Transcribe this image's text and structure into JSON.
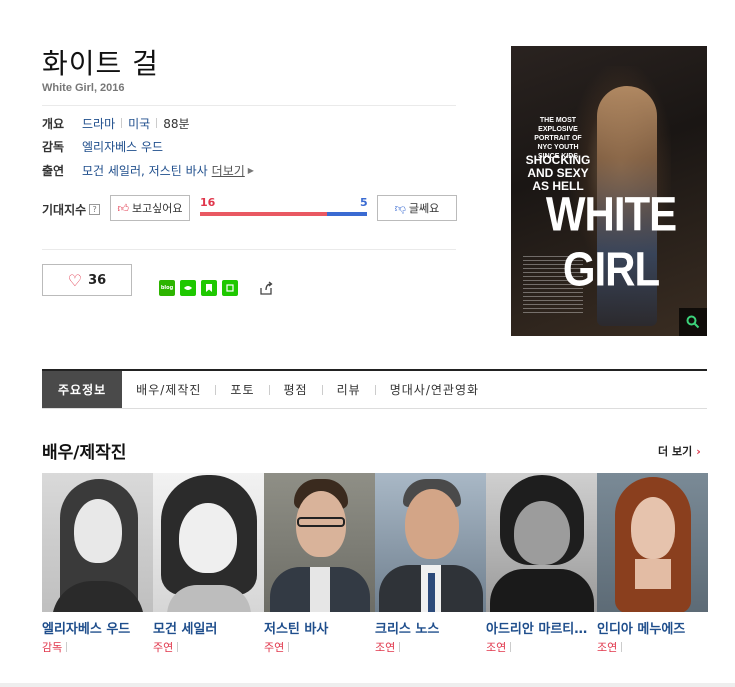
{
  "movie": {
    "title": "화이트 걸",
    "subtitle": "White Girl, 2016"
  },
  "info": {
    "overview_label": "개요",
    "genre": "드라마",
    "country": "미국",
    "runtime": "88분",
    "director_label": "감독",
    "director": "엘리자베스 우드",
    "cast_label": "출연",
    "cast_list": "모건 세일러, 저스틴 바사",
    "more": "더보기"
  },
  "expectation": {
    "label": "기대지수",
    "help": "?",
    "want_label": "보고싶어요",
    "no_label": "글쎄요",
    "want_count": "16",
    "no_count": "5",
    "want_fraction": 0.762
  },
  "like": {
    "count": "36"
  },
  "share": {
    "blog": "blog"
  },
  "poster": {
    "tagline": "THE MOST EXPLOSIVE PORTRAIT OF NYC YOUTH SINCE KIDS",
    "shock": "SHOCKING AND SEXY AS HELL",
    "main_title": "WHITE GIRL"
  },
  "tabs": [
    {
      "label": "주요정보"
    },
    {
      "label": "배우/제작진"
    },
    {
      "label": "포토"
    },
    {
      "label": "평점"
    },
    {
      "label": "리뷰"
    },
    {
      "label": "명대사/연관영화"
    }
  ],
  "section": {
    "title": "배우/제작진",
    "more": "더 보기"
  },
  "cast": [
    {
      "name": "엘리자베스 우드",
      "role": "감독"
    },
    {
      "name": "모건 세일러",
      "role": "주연"
    },
    {
      "name": "저스틴 바사",
      "role": "주연"
    },
    {
      "name": "크리스 노스",
      "role": "조연"
    },
    {
      "name": "아드리안 마르티네즈",
      "role": "조연"
    },
    {
      "name": "인디아 메누에즈",
      "role": "조연"
    }
  ],
  "colors": {
    "accent_red": "#e0364b",
    "accent_blue": "#3a6bd2",
    "link_blue": "#1f4e8c",
    "naver_green": "#1ec800"
  }
}
